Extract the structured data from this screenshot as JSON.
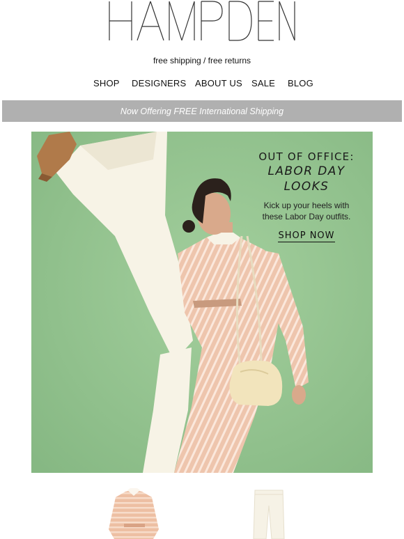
{
  "brand": {
    "logo_text": "HAMPDEN",
    "tagline": "free shipping / free returns"
  },
  "nav": {
    "items": [
      {
        "label": "SHOP"
      },
      {
        "label": "DESIGNERS"
      },
      {
        "label": "ABOUT US"
      },
      {
        "label": "SALE"
      },
      {
        "label": "BLOG"
      }
    ]
  },
  "promo": {
    "text": "Now Offering FREE International Shipping",
    "background": "#b0b0b0"
  },
  "hero": {
    "kicker": "OUT OF OFFICE:",
    "title_line1": "LABOR DAY",
    "title_line2": "LOOKS",
    "subtitle_line1": "Kick up your heels with",
    "subtitle_line2": "these Labor Day outfits.",
    "cta": "SHOP NOW",
    "background": "#93c48f"
  },
  "products": [
    {
      "icon": "striped-blouse-icon"
    },
    {
      "icon": "white-trousers-icon"
    }
  ]
}
